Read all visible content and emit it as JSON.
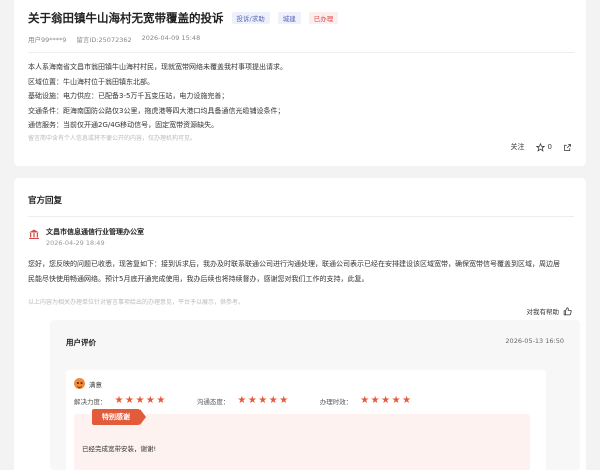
{
  "complaint": {
    "title": "关于翁田镇牛山海村无宽带覆盖的投诉",
    "tags": {
      "type": "投诉/求助",
      "category": "城建",
      "status": "已办理"
    },
    "user": "用户99****9",
    "case_no": "留言ID:25072362",
    "time": "2026-04-09 15:48",
    "body": [
      "本人系海南省文昌市翁田镇牛山海村村民，现就宽带网络未覆盖我村事项提出请求。",
      "区域位置：牛山海村位于翁田镇东北部。",
      "基础设施：电力供应：已配备3-5万千瓦变压站，电力设施完善；",
      "交通条件：距海南国防公路仅3公里，拖虎港等四大港口均具备通信光缆铺设条件；",
      "通信服务：当前仅开通2G/4G移动信号，固定宽带资源缺失。"
    ],
    "note": "留言简中含有个人信息或将不便公开的内容，仅办理机构可见。",
    "actions": {
      "follow": "关注",
      "like_count": "0"
    }
  },
  "reply": {
    "section_title": "官方回复",
    "org_name": "文昌市信息通信行业管理办公室",
    "org_time": "2026-04-29 18:49",
    "text": [
      "您好，您反映的问题已收悉，现答复如下：接到诉求后，我办及时联系联通公司进行沟通处理，联通公司表示已经在安排建设该区域宽带，确保宽带信号覆盖到区域，周边居",
      "民能尽快使用畅通网络。预计5月底开通完成使用，我办后续也将持续督办，感谢您对我们工作的支持，此复。"
    ],
    "note": "以上内容为相关办理单位针对留言事项给出的办理意见，平台予以展示，供参考。",
    "helpful": "对我有帮助"
  },
  "evaluation": {
    "title": "用户评价",
    "date": "2026-05-13 16:50",
    "user_name": "满意",
    "ratings": [
      {
        "label": "解决力度：",
        "stars": 5
      },
      {
        "label": "沟通态度：",
        "stars": 5
      },
      {
        "label": "办理时效：",
        "stars": 5
      }
    ],
    "badge": "特别感谢",
    "comment": "已经完成宽带安装，谢谢!"
  },
  "colors": {
    "accent": "#e25c3c",
    "tag_blue": "#5a6ab8",
    "status_red": "#d94a4a"
  }
}
